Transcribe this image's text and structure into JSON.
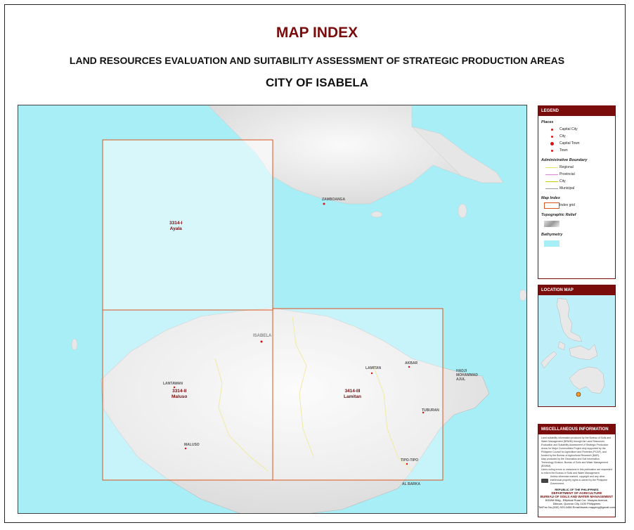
{
  "title": "MAP INDEX",
  "subtitle": "LAND RESOURCES EVALUATION AND SUITABILITY ASSESSMENT OF STRATEGIC PRODUCTION AREAS",
  "area_name": "CITY OF ISABELA",
  "map": {
    "tiles": [
      {
        "code": "3314-I",
        "name": "Ayala"
      },
      {
        "code": "3314-II",
        "name": "Maluso"
      },
      {
        "code": "3414-III",
        "name": "Lamitan"
      }
    ],
    "places": {
      "zamboanga": "ZAMBOANGA",
      "isabela": "ISABELA",
      "lantawan": "LANTAWAN",
      "maluso": "MALUSO",
      "lamitan": "LAMITAN",
      "akbar": "AKBAR",
      "hadji": "HADJI",
      "mohammad": "MOHAMMAD",
      "ajul": "AJUL",
      "tuburan": "TUBURAN",
      "tipotipo": "TIPO-TIPO",
      "albarka": "AL BARKA"
    },
    "colors": {
      "sea": "#a8eef7",
      "grid": "#d9541e",
      "land": "#f2f2f2"
    }
  },
  "legend": {
    "header": "LEGEND",
    "places_title": "Places",
    "places": [
      "Capital City",
      "City",
      "Capital Town",
      "Town"
    ],
    "admin_title": "Administrative Boundary",
    "admin": [
      {
        "label": "Regional",
        "color": "#f0e060"
      },
      {
        "label": "Provincial",
        "color": "#e080e0"
      },
      {
        "label": "City",
        "color": "#cccc00"
      },
      {
        "label": "Municipal",
        "color": "#999999"
      }
    ],
    "mapindex_title": "Map Index",
    "mapindex_item": "Index grid",
    "relief_title": "Topographic Relief",
    "bathy_title": "Bathymetry"
  },
  "location_map": {
    "header": "LOCATION MAP"
  },
  "misc": {
    "header": "MISCELLANEOUS INFORMATION",
    "text1": "Land suitability information produced by the Bureau of Soils and Water Management (BSWM) through the Land Resources Evaluation and Suitability Assessment of Strategic Production Areas for Major Commodities Project duly supported by the Philippine Council for Agriculture and Fisheries (PCAF), and funded by the Bureau of Agricultural Research (BAR).",
    "text2": "Map produced by the Geomatics and Soil Information Technology Division, Bureau of Soils and Water Management (BSWM).",
    "text3": "Users noting errors or omissions in this publication are requested to inform the Bureau of Soils and Water Management.",
    "text4": "Unless otherwise marked, copyright and any other intellectual property rights is owned by the Philippine Government.",
    "agency1": "REPUBLIC OF THE PHILIPPINES",
    "agency2": "DEPARTMENT OF AGRICULTURE",
    "agency3": "BUREAU OF SOILS AND WATER MANAGEMENT",
    "address1": "BSWM Bldg., Elliptical Road Cor. Visayas Avenue,",
    "address2": "Diliman, Quezon City 1100 Philippines",
    "contact": "Tel/Fax No.(632) 923-0456    Email:bswm.mapping@gmail.com"
  }
}
